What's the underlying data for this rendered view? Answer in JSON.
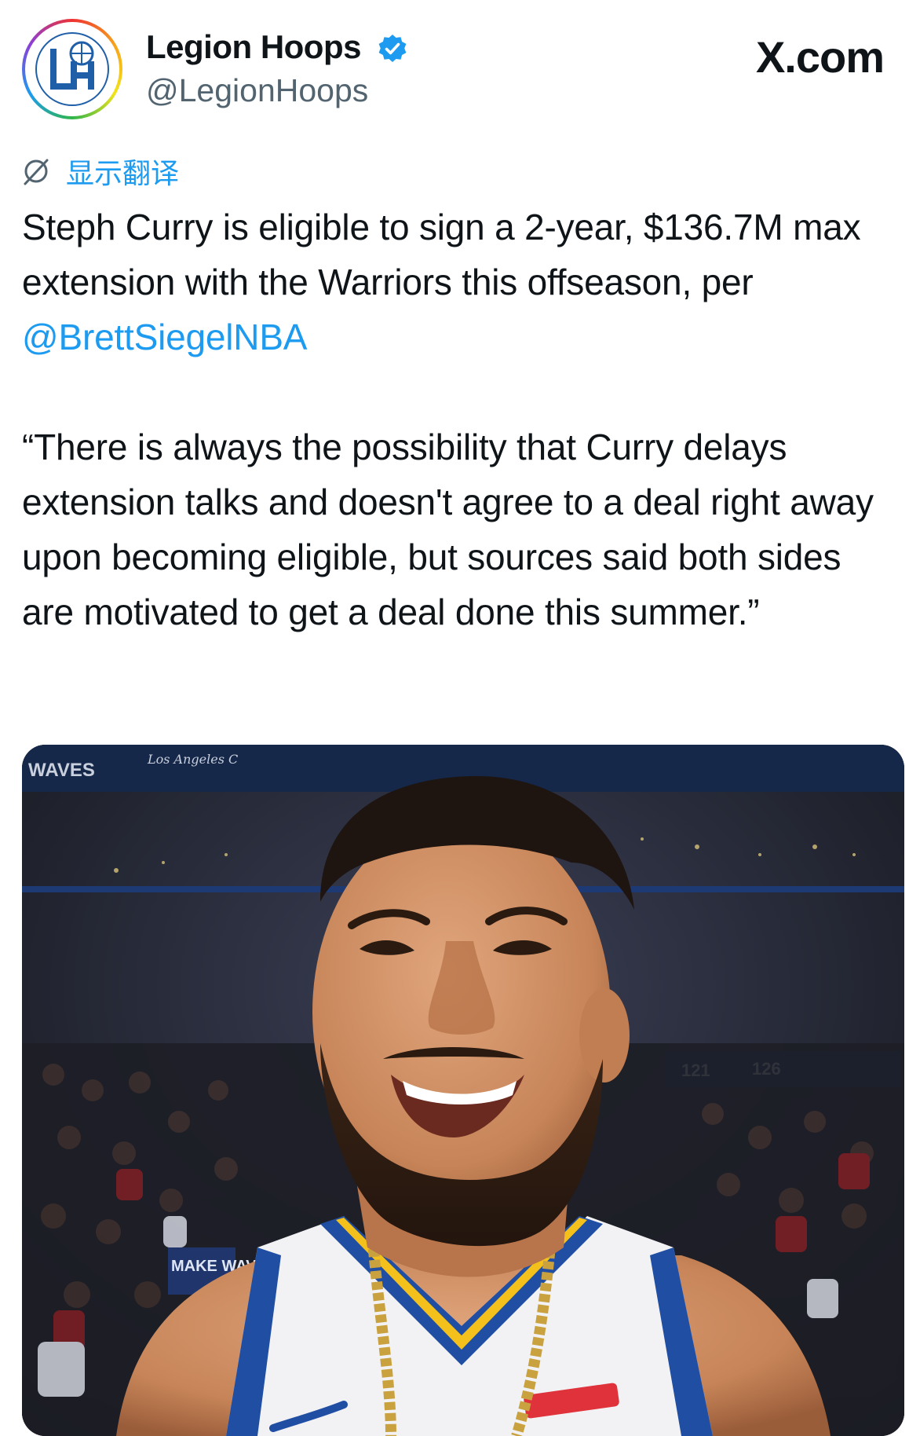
{
  "account": {
    "display_name": "Legion Hoops",
    "handle": "@LegionHoops",
    "avatar_logo_text": "LH"
  },
  "brand_label": "X.com",
  "translate": {
    "label": "显示翻译"
  },
  "tweet": {
    "para1_text": "Steph Curry is eligible to sign a 2-year, $136.7M max extension with the Warriors this offseason, per ",
    "para1_mention": "@BrettSiegelNBA",
    "para2_text": "“There is always the possibility that Curry delays extension talks and doesn't agree to a deal right away upon becoming eligible, but sources said both sides are motivated to get a deal done this summer.”"
  },
  "media": {
    "arena_text_left": "WAVES",
    "arena_text_script": "Los Angeles C",
    "scoreboard": [
      "121",
      "126"
    ],
    "crowd_sign": "MAKE WAVES"
  },
  "colors": {
    "link": "#1d9bf0",
    "text": "#0f1419",
    "secondary": "#536471",
    "jersey_blue": "#1f4ea3",
    "jersey_gold": "#f4c01b"
  }
}
